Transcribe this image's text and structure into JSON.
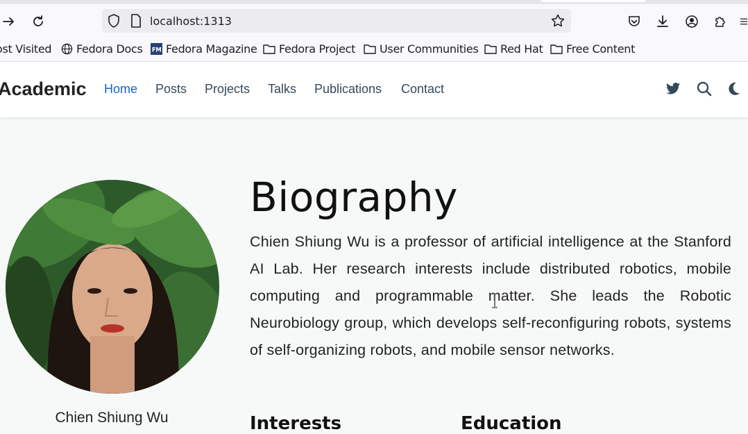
{
  "browser": {
    "url": "localhost:1313",
    "bookmarks": [
      {
        "label": "ost Visited",
        "icon": "gear-icon"
      },
      {
        "label": "Fedora Docs",
        "icon": "globe-icon"
      },
      {
        "label": "Fedora Magazine",
        "icon": "fedora-magazine-icon"
      },
      {
        "label": "Fedora Project",
        "icon": "folder-icon"
      },
      {
        "label": "User Communities",
        "icon": "folder-icon"
      },
      {
        "label": "Red Hat",
        "icon": "folder-icon"
      },
      {
        "label": "Free Content",
        "icon": "folder-icon"
      }
    ]
  },
  "site": {
    "brand": "Academic",
    "nav": [
      {
        "label": "Home",
        "active": true
      },
      {
        "label": "Posts",
        "active": false
      },
      {
        "label": "Projects",
        "active": false
      },
      {
        "label": "Talks",
        "active": false
      },
      {
        "label": "Publications",
        "active": false
      },
      {
        "label": "Contact",
        "active": false
      }
    ],
    "nav_icons": [
      "twitter-icon",
      "search-icon",
      "moon-icon"
    ],
    "accent_color": "#1565c0"
  },
  "profile": {
    "name": "Chien Shiung Wu"
  },
  "bio": {
    "title": "Biography",
    "text": "Chien Shiung Wu is a professor of artificial intelligence at the Stanford AI Lab. Her research interests include distributed robotics, mobile computing and programmable matter. She leads the Robotic Neurobiology group, which develops self-reconfiguring robots, systems of self-organizing robots, and mobile sensor networks.",
    "interests_heading": "Interests",
    "education_heading": "Education"
  }
}
